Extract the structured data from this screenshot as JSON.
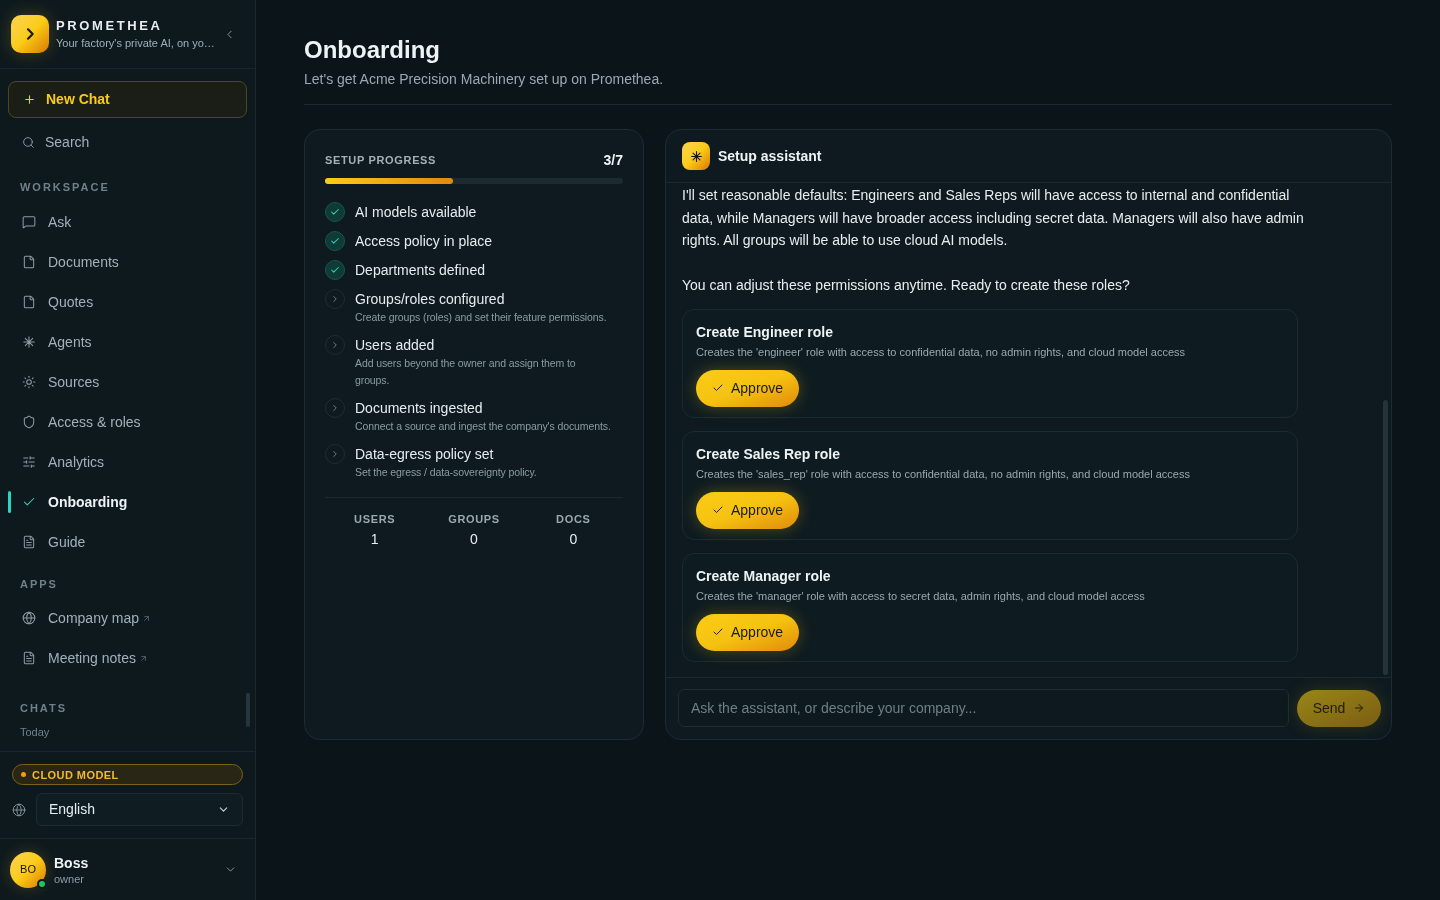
{
  "sidebar": {
    "brand": {
      "name": "PROMETHEA",
      "tagline": "Your factory's private AI, on yo…"
    },
    "new_chat": "New Chat",
    "search": "Search",
    "workspace": {
      "title": "WORKSPACE",
      "items": [
        {
          "label": "Ask",
          "selected": false
        },
        {
          "label": "Documents",
          "selected": false
        },
        {
          "label": "Quotes",
          "selected": false
        },
        {
          "label": "Agents",
          "selected": false
        },
        {
          "label": "Sources",
          "selected": false
        },
        {
          "label": "Access & roles",
          "selected": false
        },
        {
          "label": "Analytics",
          "selected": false
        },
        {
          "label": "Onboarding",
          "selected": true
        },
        {
          "label": "Guide",
          "selected": false
        }
      ]
    },
    "apps": {
      "title": "APPS",
      "items": [
        {
          "label": "Company map",
          "selected": false,
          "external": true
        },
        {
          "label": "Meeting notes",
          "selected": false,
          "external": true
        }
      ]
    },
    "chats": {
      "title": "CHATS",
      "group": "Today"
    },
    "model_badge": "CLOUD MODEL",
    "language": "English",
    "user": {
      "initials": "BO",
      "name": "Boss",
      "role": "owner",
      "online": true
    }
  },
  "page": {
    "title": "Onboarding",
    "subtitle": "Let's get Acme Precision Machinery set up on Promethea."
  },
  "progress": {
    "title": "SETUP PROGRESS",
    "count": "3/7",
    "level": 0.43,
    "steps": [
      {
        "title": "AI models available",
        "done": true
      },
      {
        "title": "Access policy in place",
        "done": true
      },
      {
        "title": "Departments defined",
        "done": true
      },
      {
        "title": "Groups/roles configured",
        "description": "Create groups (roles) and set their feature permissions.",
        "done": false
      },
      {
        "title": "Users added",
        "description": "Add users beyond the owner and assign them to groups.",
        "done": false
      },
      {
        "title": "Documents ingested",
        "description": "Connect a source and ingest the company's documents.",
        "done": false
      },
      {
        "title": "Data-egress policy set",
        "description": "Set the egress / data-sovereignty policy.",
        "done": false
      }
    ],
    "stats": [
      {
        "label": "USERS",
        "value": "1"
      },
      {
        "label": "GROUPS",
        "value": "0"
      },
      {
        "label": "DOCS",
        "value": "0"
      }
    ]
  },
  "assistant": {
    "title": "Setup assistant",
    "message": [
      "I'll set reasonable defaults: Engineers and Sales Reps will have access to internal and confidential data, while Managers will have broader access including secret data. Managers will also have admin rights. All groups will be able to use cloud AI models.",
      "You can adjust these permissions anytime. Ready to create these roles?"
    ],
    "actions": [
      {
        "title": "Create Engineer role",
        "description": "Creates the 'engineer' role with access to confidential data, no admin rights, and cloud model access",
        "button": "Approve"
      },
      {
        "title": "Create Sales Rep role",
        "description": "Creates the 'sales_rep' role with access to confidential data, no admin rights, and cloud model access",
        "button": "Approve"
      },
      {
        "title": "Create Manager role",
        "description": "Creates the 'manager' role with access to secret data, admin rights, and cloud model access",
        "button": "Approve"
      }
    ],
    "input": {
      "placeholder": "Ask the assistant, or describe your company..."
    },
    "send": {
      "label": "Send",
      "disabled": true
    }
  }
}
